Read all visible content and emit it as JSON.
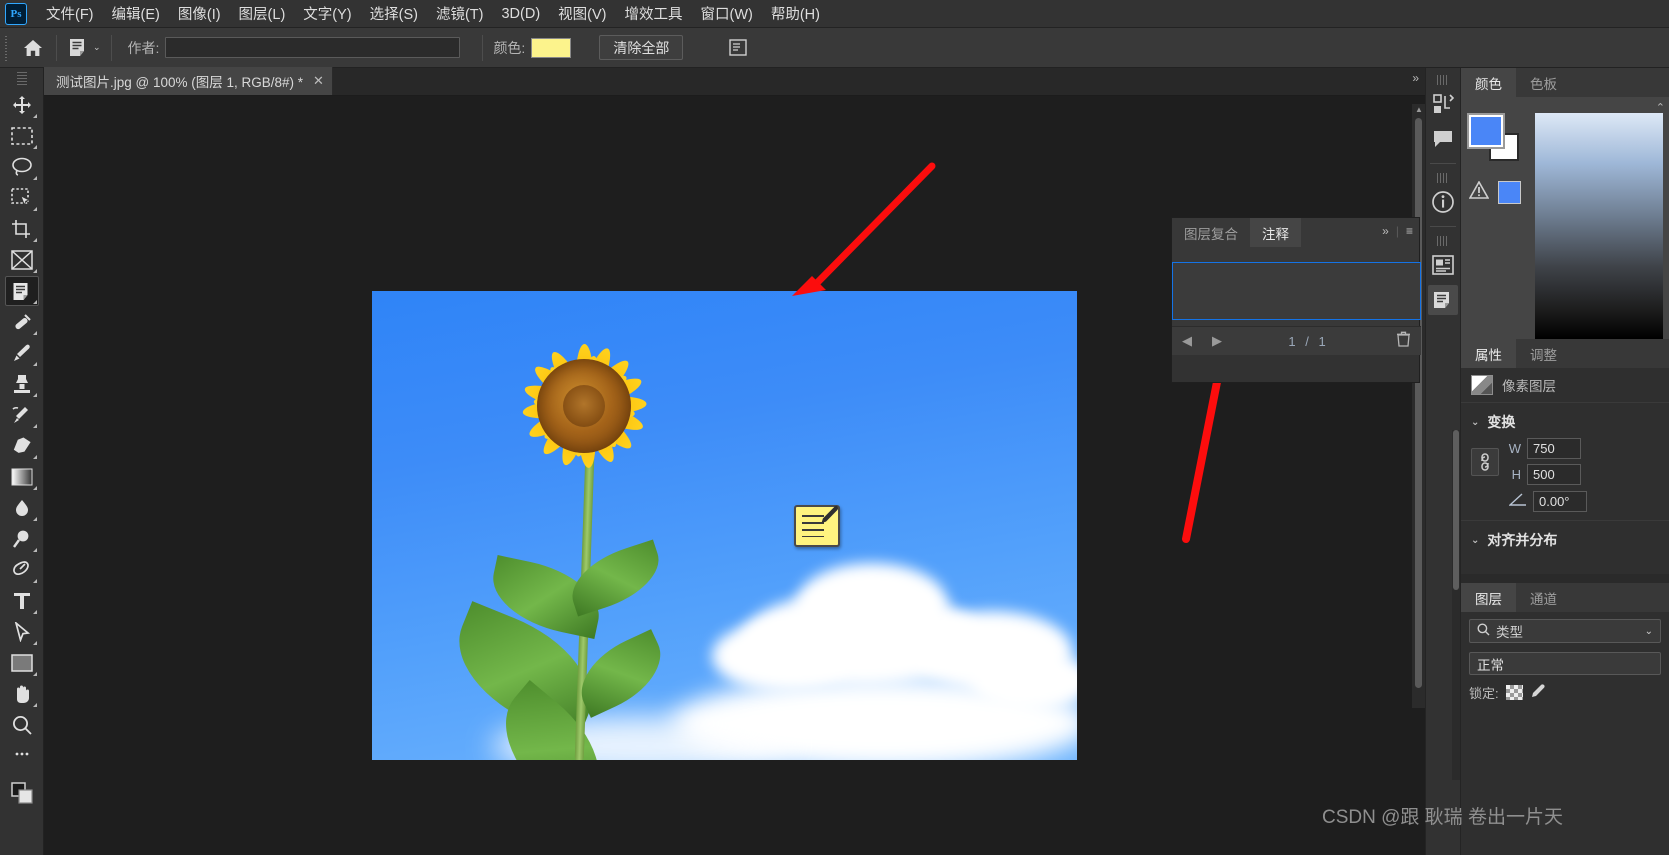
{
  "app": {
    "logo": "Ps"
  },
  "menubar": {
    "items": [
      {
        "label": "文件(F)",
        "name": "menu-file"
      },
      {
        "label": "编辑(E)",
        "name": "menu-edit"
      },
      {
        "label": "图像(I)",
        "name": "menu-image"
      },
      {
        "label": "图层(L)",
        "name": "menu-layer"
      },
      {
        "label": "文字(Y)",
        "name": "menu-type"
      },
      {
        "label": "选择(S)",
        "name": "menu-select"
      },
      {
        "label": "滤镜(T)",
        "name": "menu-filter"
      },
      {
        "label": "3D(D)",
        "name": "menu-3d"
      },
      {
        "label": "视图(V)",
        "name": "menu-view"
      },
      {
        "label": "增效工具",
        "name": "menu-plugins"
      },
      {
        "label": "窗口(W)",
        "name": "menu-window"
      },
      {
        "label": "帮助(H)",
        "name": "menu-help"
      }
    ]
  },
  "optionsbar": {
    "author_label": "作者:",
    "author_value": "",
    "author_placeholder": "",
    "color_label": "颜色:",
    "color_value": "#FCF38C",
    "clear_all_label": "清除全部",
    "home_icon": "home-icon",
    "tool_icon": "note-tool-icon",
    "preset_caret": "⌄",
    "right_icon": "notes-panel-toggle-icon"
  },
  "toolbar": {
    "tools": [
      {
        "name": "move-tool",
        "icon": "move-icon",
        "active": false
      },
      {
        "name": "marquee-tool",
        "icon": "rectangular-marquee-icon",
        "active": false
      },
      {
        "name": "lasso-tool",
        "icon": "lasso-icon",
        "active": false
      },
      {
        "name": "object-selection-tool",
        "icon": "object-selection-icon",
        "active": false
      },
      {
        "name": "crop-tool",
        "icon": "crop-icon",
        "active": false
      },
      {
        "name": "frame-tool",
        "icon": "frame-icon",
        "active": false
      },
      {
        "name": "note-tool",
        "icon": "note-icon",
        "active": true
      },
      {
        "name": "eyedropper-tool",
        "icon": "eyedropper-icon",
        "active": false
      },
      {
        "name": "brush-tool",
        "icon": "brush-icon",
        "active": false
      },
      {
        "name": "clone-stamp-tool",
        "icon": "clone-stamp-icon",
        "active": false
      },
      {
        "name": "history-brush-tool",
        "icon": "history-brush-icon",
        "active": false
      },
      {
        "name": "eraser-tool",
        "icon": "eraser-icon",
        "active": false
      },
      {
        "name": "gradient-tool",
        "icon": "gradient-icon",
        "active": false
      },
      {
        "name": "blur-tool",
        "icon": "blur-drop-icon",
        "active": false
      },
      {
        "name": "dodge-tool",
        "icon": "dodge-icon",
        "active": false
      },
      {
        "name": "pen-tool",
        "icon": "pen-icon",
        "active": false
      },
      {
        "name": "type-tool",
        "icon": "type-t-icon",
        "active": false
      },
      {
        "name": "path-selection-tool",
        "icon": "path-arrow-icon",
        "active": false
      },
      {
        "name": "shape-tool",
        "icon": "rectangle-shape-icon",
        "active": false
      },
      {
        "name": "hand-tool",
        "icon": "hand-icon",
        "active": false
      },
      {
        "name": "zoom-tool",
        "icon": "magnifier-icon",
        "active": false
      },
      {
        "name": "edit-toolbar",
        "icon": "ellipsis-icon",
        "active": false
      }
    ]
  },
  "document": {
    "tab_title": "测试图片.jpg @ 100% (图层 1, RGB/8#) *",
    "close_glyph": "✕",
    "overflow_glyph": "»"
  },
  "notes_panel": {
    "tabs": [
      {
        "label": "图层复合",
        "name": "tab-layer-comps",
        "active": false
      },
      {
        "label": "注释",
        "name": "tab-notes",
        "active": true
      }
    ],
    "collapse_glyph": "»",
    "menu_glyph": "≡",
    "note_text": "",
    "prev_glyph": "◀",
    "next_glyph": "▶",
    "page_current": "1",
    "page_sep": "/",
    "page_total": "1",
    "trash_glyph": "🗑"
  },
  "rail": {
    "icons": [
      {
        "name": "layer-comps-icon",
        "active": false
      },
      {
        "name": "notes-icon",
        "active": false
      },
      {
        "name": "info-icon",
        "active": false
      },
      {
        "name": "properties-icon",
        "active": false
      },
      {
        "name": "notes-panel-icon",
        "active": true
      }
    ]
  },
  "color_panel": {
    "tabs": [
      {
        "label": "颜色",
        "name": "tab-color",
        "active": true
      },
      {
        "label": "色板",
        "name": "tab-swatches",
        "active": false
      }
    ],
    "foreground": "#4A86F7",
    "background": "#FFFFFF",
    "warning_glyph": "⚠",
    "warning_color": "#4A86F7"
  },
  "properties_panel": {
    "tabs": [
      {
        "label": "属性",
        "name": "tab-properties",
        "active": true
      },
      {
        "label": "调整",
        "name": "tab-adjustments",
        "active": false
      }
    ],
    "layer_kind": "像素图层",
    "transform_section": "变换",
    "w_label": "W",
    "w_value": "750",
    "h_label": "H",
    "h_value": "500",
    "angle_value": "0.00°",
    "align_section": "对齐并分布",
    "chevron": "⌄"
  },
  "layers_panel": {
    "tabs": [
      {
        "label": "图层",
        "name": "tab-layers",
        "active": true
      },
      {
        "label": "通道",
        "name": "tab-channels",
        "active": false
      }
    ],
    "filter_label": "类型",
    "filter_caret": "⌄",
    "blend_mode": "正常",
    "lock_label": "锁定:"
  },
  "canvas": {
    "note_marker_name": "canvas-note-marker",
    "photo_alt": "sunflower-against-blue-sky"
  },
  "watermark": {
    "text": "CSDN @跟 耿瑞 卷出一片天"
  }
}
